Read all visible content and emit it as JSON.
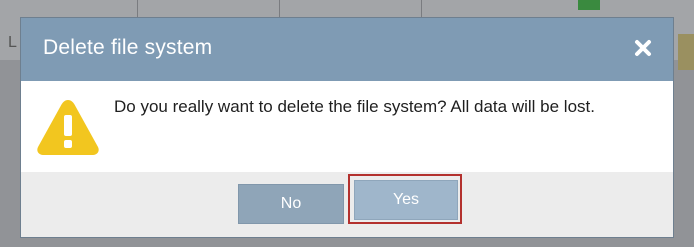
{
  "dialog": {
    "title": "Delete file system",
    "message": "Do you really want to delete the file system? All data will be lost.",
    "close_icon": "close-icon",
    "warning_icon": "warning-triangle-icon"
  },
  "buttons": {
    "no_label": "No",
    "yes_label": "Yes"
  },
  "background": {
    "partial_letter": "L"
  },
  "colors": {
    "header": "#7f9bb4",
    "button_no": "#8fa5b8",
    "button_yes": "#9fb6cb",
    "focus_outline": "#b3312e",
    "warning": "#f2c61f"
  }
}
